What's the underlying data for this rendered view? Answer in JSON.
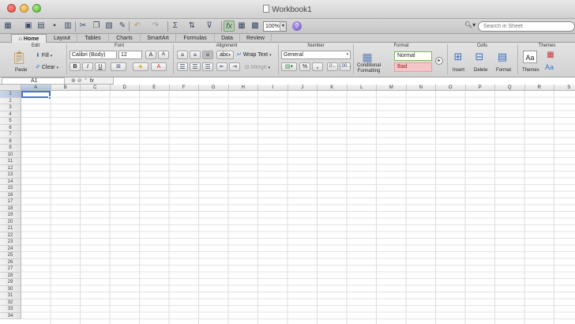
{
  "window": {
    "title": "Workbook1"
  },
  "toolbar": {
    "zoom": "100%",
    "help_label": "?",
    "search_placeholder": "Search in Sheet"
  },
  "ribbon_tabs": [
    "Home",
    "Layout",
    "Tables",
    "Charts",
    "SmartArt",
    "Formulas",
    "Data",
    "Review"
  ],
  "active_tab": "Home",
  "ribbon": {
    "groups": {
      "edit": "Edit",
      "font": "Font",
      "alignment": "Alignment",
      "number": "Number",
      "format": "Format",
      "cells": "Cells",
      "themes": "Themes"
    },
    "edit": {
      "paste": "Paste",
      "fill": "Fill",
      "clear": "Clear"
    },
    "font": {
      "family": "Calibri (Body)",
      "size": "12",
      "grow": "A",
      "shrink": "A",
      "bold": "B",
      "italic": "I",
      "underline": "U"
    },
    "alignment": {
      "abc": "abc",
      "wrap_text": "Wrap Text",
      "merge": "Merge"
    },
    "number": {
      "format": "General",
      "percent": "%",
      "comma": ","
    },
    "format": {
      "conditional_line1": "Conditional",
      "conditional_line2": "Formatting",
      "style_normal": "Normal",
      "style_bad": "Bad"
    },
    "cells": {
      "insert": "Insert",
      "delete": "Delete",
      "format": "Format"
    },
    "themes": {
      "themes": "Themes",
      "aa": "Aa"
    }
  },
  "formula_bar": {
    "cell_ref": "A1",
    "fx": "fx",
    "value": ""
  },
  "grid": {
    "columns": [
      "A",
      "B",
      "C",
      "D",
      "E",
      "F",
      "G",
      "H",
      "I",
      "J",
      "K",
      "L",
      "M",
      "N",
      "O",
      "P",
      "Q",
      "R",
      "S"
    ],
    "rows": [
      "1",
      "2",
      "3",
      "4",
      "5",
      "6",
      "7",
      "8",
      "9",
      "10",
      "11",
      "12",
      "13",
      "14",
      "15",
      "16",
      "17",
      "18",
      "19",
      "20",
      "21",
      "22",
      "23",
      "24",
      "25",
      "26",
      "27",
      "28",
      "29",
      "30",
      "31",
      "32",
      "33",
      "34"
    ],
    "selected_cell": "A1"
  }
}
